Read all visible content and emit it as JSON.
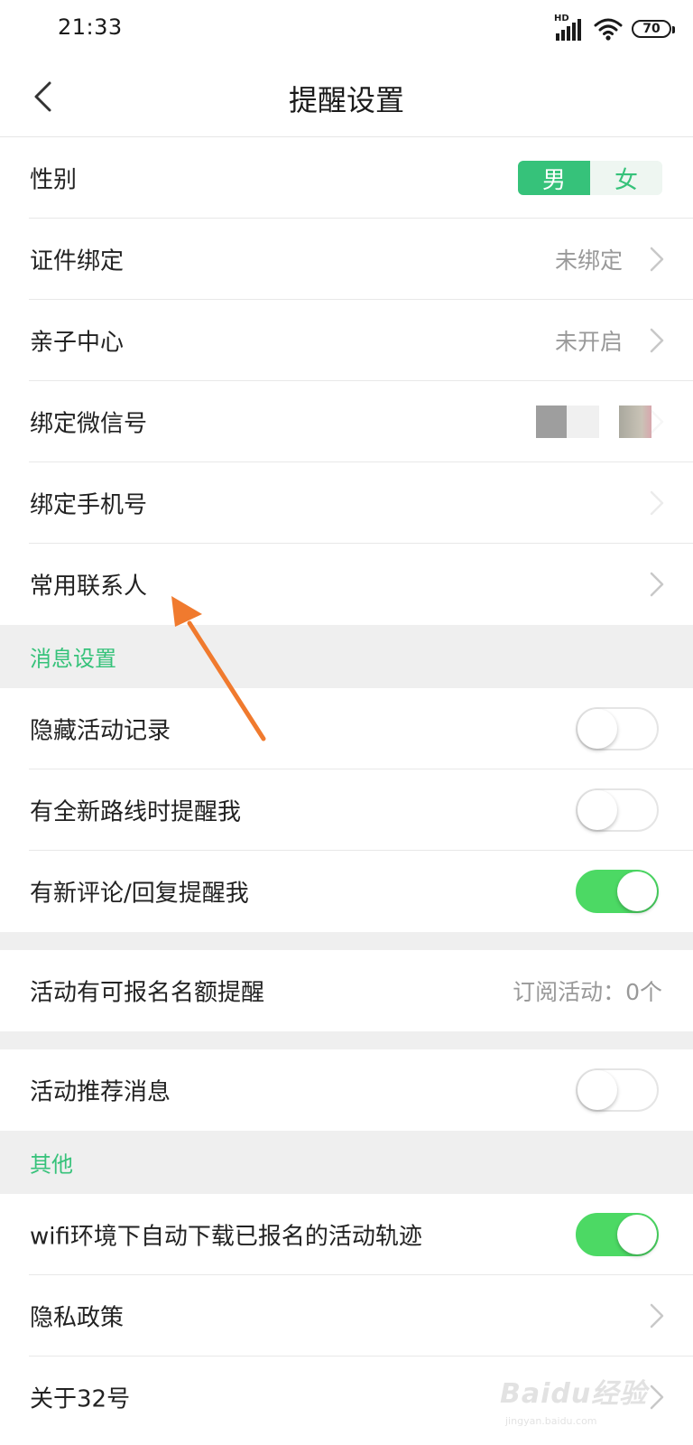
{
  "status_bar": {
    "time": "21:33",
    "hd": "HD",
    "battery": "70"
  },
  "header": {
    "title": "提醒设置",
    "back_icon": "chevron-left-icon"
  },
  "profile": {
    "gender": {
      "label": "性别",
      "options": [
        "男",
        "女"
      ],
      "selected": "男"
    },
    "id_binding": {
      "label": "证件绑定",
      "value": "未绑定"
    },
    "parent_center": {
      "label": "亲子中心",
      "value": "未开启"
    },
    "wechat": {
      "label": "绑定微信号"
    },
    "phone": {
      "label": "绑定手机号"
    },
    "contacts": {
      "label": "常用联系人"
    }
  },
  "message_settings": {
    "section_title": "消息设置",
    "hide_activity": {
      "label": "隐藏活动记录",
      "on": false
    },
    "new_route": {
      "label": "有全新路线时提醒我",
      "on": false
    },
    "new_comment": {
      "label": "有新评论/回复提醒我",
      "on": true
    },
    "quota": {
      "label": "活动有可报名名额提醒",
      "value": "订阅活动：0个"
    },
    "recommend": {
      "label": "活动推荐消息",
      "on": false
    }
  },
  "other": {
    "section_title": "其他",
    "wifi_download": {
      "label": "wifi环境下自动下载已报名的活动轨迹",
      "on": true
    },
    "privacy": {
      "label": "隐私政策"
    },
    "about": {
      "label": "关于32号"
    }
  },
  "watermark": {
    "brand": "Baidu经验",
    "url": "jingyan.baidu.com"
  },
  "colors": {
    "accent": "#36c27a",
    "toggle_on": "#4cd964",
    "section_bg": "#efefef",
    "muted_text": "#999999",
    "annotation_arrow": "#f07a2e"
  }
}
